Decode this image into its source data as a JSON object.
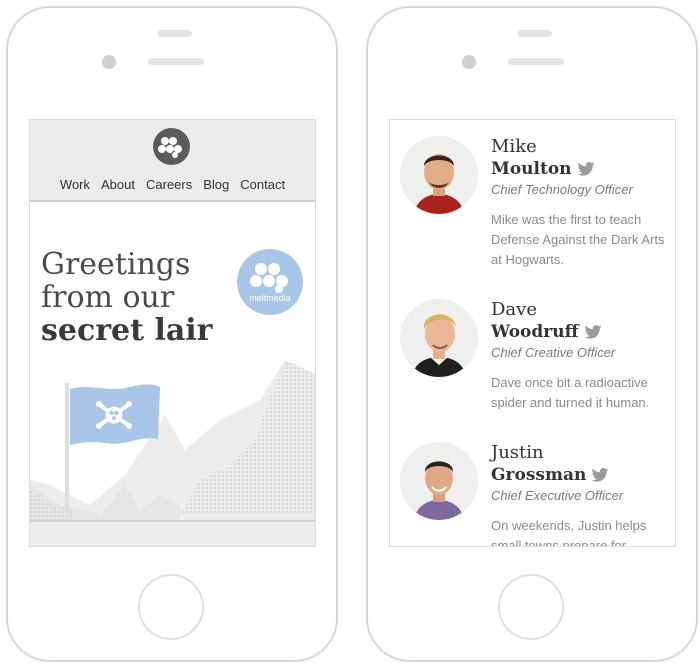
{
  "left_phone": {
    "nav": [
      "Work",
      "About",
      "Careers",
      "Blog",
      "Contact"
    ],
    "headline": {
      "line1": "Greetings",
      "line2": "from our",
      "line3": "secret lair"
    },
    "badge_text": "meltmedia"
  },
  "right_phone": {
    "team": [
      {
        "first": "Mike",
        "last": "Moulton",
        "title": "Chief Technology Officer",
        "bio": "Mike was the first to teach Defense Against the Dark Arts at Hogwarts."
      },
      {
        "first": "Dave",
        "last": "Woodruff",
        "title": "Chief Creative Officer",
        "bio": "Dave once bit a radioactive spider and turned it human."
      },
      {
        "first": "Justin",
        "last": "Grossman",
        "title": "Chief Executive Officer",
        "bio": "On weekends, Justin helps small towns prepare for"
      }
    ]
  },
  "colors": {
    "accent_blue": "#a8c7e8",
    "twitter_gray": "#9a9a9a",
    "frame": "#d6d6d6"
  },
  "icons": [
    "logo-icon",
    "twitter-icon",
    "skull-crossbones-icon"
  ]
}
